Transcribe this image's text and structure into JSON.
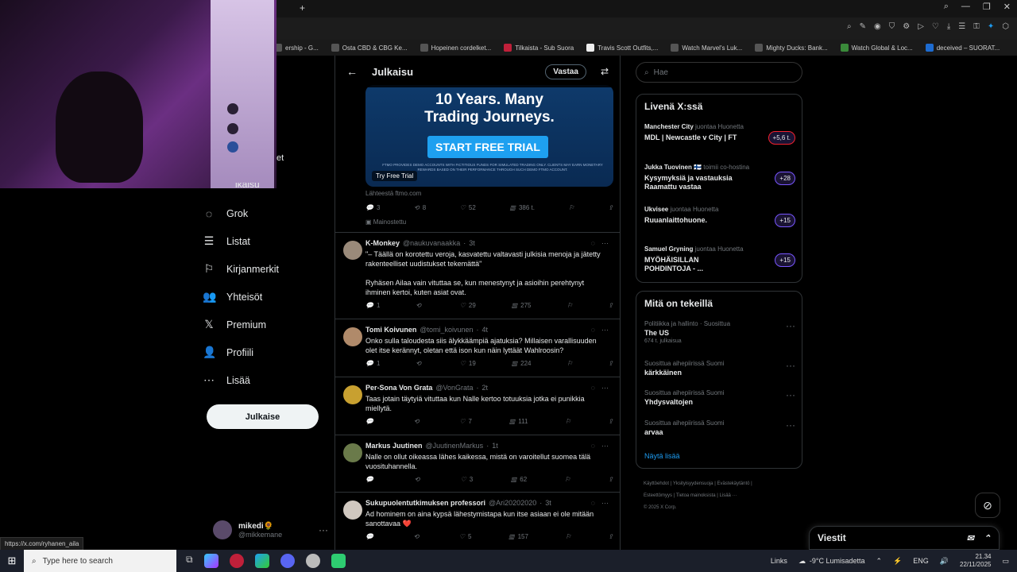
{
  "bookmarks": [
    "ership - G...",
    "Osta CBD & CBG Ke...",
    "Hopeinen cordelket...",
    "Tilkaista - Sub Suora",
    "Travis Scott Outfits,...",
    "Watch Marvel's Luk...",
    "Mighty Ducks: Bank...",
    "Watch Global & Loc...",
    "deceived – SUORAT..."
  ],
  "sidebar": {
    "items": [
      {
        "icon": "grok-icon",
        "label": "Grok"
      },
      {
        "icon": "list-icon",
        "label": "Listat"
      },
      {
        "icon": "bookmark-icon",
        "label": "Kirjanmerkit"
      },
      {
        "icon": "communities-icon",
        "label": "Yhteisöt"
      },
      {
        "icon": "x-logo-icon",
        "label": "Premium"
      },
      {
        "icon": "profile-icon",
        "label": "Profiili"
      },
      {
        "icon": "more-icon",
        "label": "Lisää"
      }
    ],
    "post": "Julkaise",
    "partial_label": "et",
    "partial_top": "ikaisu"
  },
  "profile": {
    "name": "mikedi🌻",
    "handle": "@mikkemane"
  },
  "status_url": "https://x.com/ryhanen_aila",
  "header": {
    "title": "Julkaisu",
    "reply": "Vastaa"
  },
  "ad": {
    "headline1": "10 Years. Many",
    "headline2": "Trading Journeys.",
    "cta": "START FREE TRIAL",
    "fine": "FTMO PROVIDES DEMO ACCOUNTS WITH FICTITIOUS FUNDS FOR SIMULATED TRADING ONLY. CLIENTS MAY EARN MONETARY REWARDS BASED ON THEIR PERFORMANCE THROUGH SUCH DEMO FTMO ACCOUNT.",
    "badge": "Try Free Trial",
    "source": "Lähteestä ftmo.com",
    "replies": "3",
    "reposts": "8",
    "likes": "52",
    "views": "386 t.",
    "promoted": "Mainostettu"
  },
  "tweets": [
    {
      "name": "K-Monkey",
      "handle": "@naukuvanaakka",
      "time": "3t",
      "text": "\"– Täällä on korotettu veroja, kasvatettu valtavasti julkisia menoja ja jätetty rakenteelliset uudistukset tekemättä\"\n\nRyhäsen Ailaa vain vituttaa se, kun menestynyt ja asioihin perehtynyt ihminen kertoi, kuten asiat ovat.",
      "replies": "1",
      "reposts": "",
      "likes": "29",
      "views": "275",
      "color": "#9a8a7a"
    },
    {
      "name": "Tomi Koivunen",
      "handle": "@tomi_koivunen",
      "time": "4t",
      "text": "Onko sulla taloudesta siis älykkäämpiä ajatuksia? Millaisen varallisuuden olet itse kerännyt, oletan että ison kun näin lyttäät Wahlroosin?",
      "replies": "1",
      "reposts": "",
      "likes": "19",
      "views": "224",
      "color": "#b08a6a"
    },
    {
      "name": "Per-Sona Von Grata",
      "handle": "@VonGrata",
      "time": "2t",
      "text": "Taas jotain täytyiä vituttaa kun Nalle kertoo totuuksia jotka ei punikkia miellytä.",
      "replies": "",
      "reposts": "",
      "likes": "7",
      "views": "111",
      "color": "#c8a030"
    },
    {
      "name": "Markus Juutinen",
      "handle": "@JuutinenMarkus",
      "time": "1t",
      "text": "Nalle on ollut oikeassa lähes kaikessa, mistä on varoitellut suomea tälä vuosituhannella.",
      "replies": "",
      "reposts": "",
      "likes": "3",
      "views": "62",
      "color": "#6a7a4a"
    },
    {
      "name": "Sukupuolentutkimuksen professori",
      "handle": "@Ari20202020",
      "time": "3t",
      "text": "Ad hominem on aina kypsä lähestymistapa kun itse asiaan ei ole mitään sanottavaa ❤️",
      "replies": "",
      "reposts": "",
      "likes": "5",
      "views": "157",
      "color": "#d0c8c0"
    }
  ],
  "search": {
    "placeholder": "Hae"
  },
  "live": {
    "title": "Livenä X:ssä",
    "items": [
      {
        "host": "Manchester City",
        "role": "juontaa Huonetta",
        "title": "MDL | Newcastle v City | FT",
        "count": "+5,6 t."
      },
      {
        "host": "Jukka Tuovinen 🇫🇮",
        "role": "toimii co-hostina",
        "title": "Kysymyksiä ja vastauksia Raamattu vastaa",
        "count": "+28"
      },
      {
        "host": "Ukvisee",
        "role": "juontaa Huonetta",
        "title": "Ruuanlaittohuone.",
        "count": "+15"
      },
      {
        "host": "Samuel Gryning",
        "role": "juontaa Huonetta",
        "title": "MYÖHÄISILLAN POHDINTOJA - ...",
        "count": "+15"
      }
    ]
  },
  "trends": {
    "title": "Mitä on tekeillä",
    "items": [
      {
        "category": "Politiikka ja hallinto · Suosittua",
        "name": "The US",
        "sub": "674 t. julkaisua"
      },
      {
        "category": "Suosittua aihepiirissä Suomi",
        "name": "kärkkäinen",
        "sub": ""
      },
      {
        "category": "Suosittua aihepiirissä Suomi",
        "name": "Yhdysvaltojen",
        "sub": ""
      },
      {
        "category": "Suosittua aihepiirissä Suomi",
        "name": "arvaa",
        "sub": ""
      }
    ],
    "show_more": "Näytä lisää"
  },
  "footer": {
    "line1": [
      "Käyttöehdot",
      "Yksityisyydensuoja",
      "Evästekäytäntö"
    ],
    "line2": [
      "Esteettömyys",
      "Tietoa mainoksista",
      "Lisää ···"
    ],
    "line3": "© 2025 X Corp."
  },
  "messages": {
    "title": "Viestit"
  },
  "taskbar": {
    "search_placeholder": "Type here to search",
    "links": "Links",
    "weather": "-9°C  Lumisadetta",
    "lang": "ENG",
    "time": "21.34",
    "date": "22/11/2025"
  }
}
